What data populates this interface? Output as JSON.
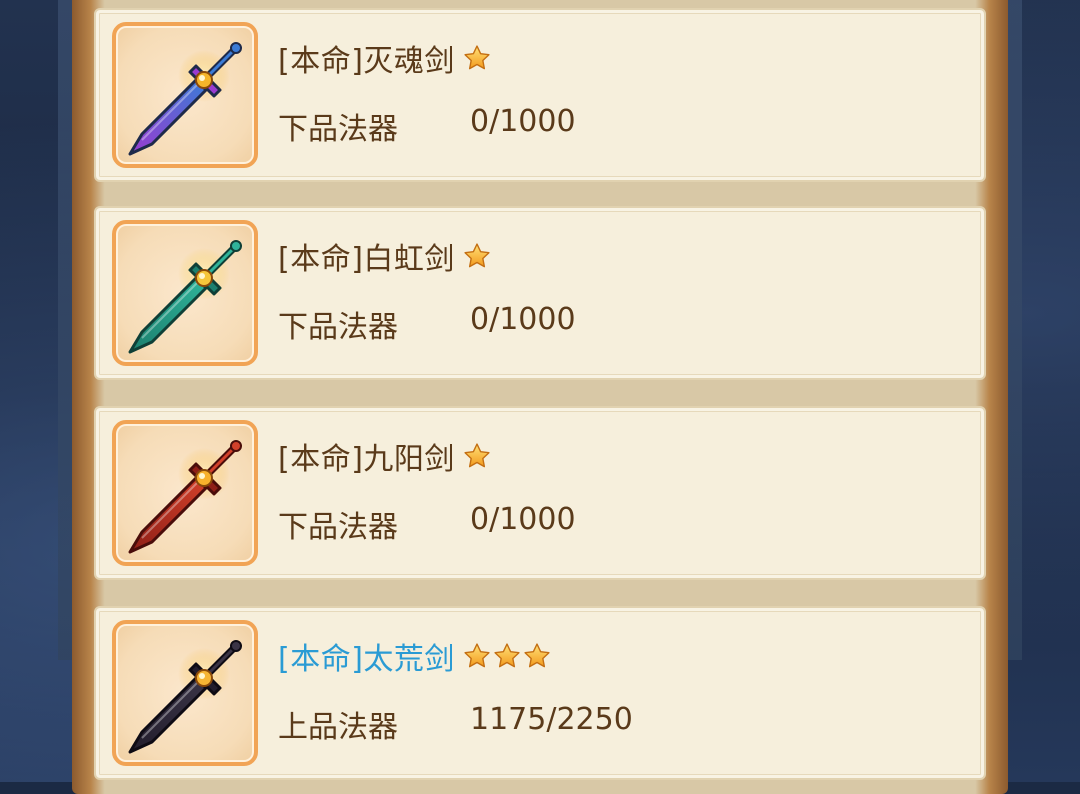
{
  "items": [
    {
      "name": "[本命]灭魂剑",
      "stars": 1,
      "grade": "下品法器",
      "progress": "0/1000",
      "highlight": false,
      "icon": "rainbow-sword-icon",
      "colors": {
        "blade": "#3b7bd6",
        "blade2": "#9a3bd0",
        "edge": "#1e2a4a",
        "gem": "#f5b52a"
      }
    },
    {
      "name": "[本命]白虹剑",
      "stars": 1,
      "grade": "下品法器",
      "progress": "0/1000",
      "highlight": false,
      "icon": "jade-sword-icon",
      "colors": {
        "blade": "#2fb39a",
        "blade2": "#1c7f6e",
        "edge": "#0f3f37",
        "gem": "#f6c63b"
      }
    },
    {
      "name": "[本命]九阳剑",
      "stars": 1,
      "grade": "下品法器",
      "progress": "0/1000",
      "highlight": false,
      "icon": "flame-sword-icon",
      "colors": {
        "blade": "#d2402a",
        "blade2": "#8e1f17",
        "edge": "#4a0d0a",
        "gem": "#f8b12c"
      }
    },
    {
      "name": "[本命]太荒剑",
      "stars": 3,
      "grade": "上品法器",
      "progress": "1175/2250",
      "highlight": true,
      "icon": "dark-sword-icon",
      "colors": {
        "blade": "#3a3446",
        "blade2": "#221d2c",
        "edge": "#0e0b14",
        "gem": "#f6b534"
      }
    }
  ]
}
